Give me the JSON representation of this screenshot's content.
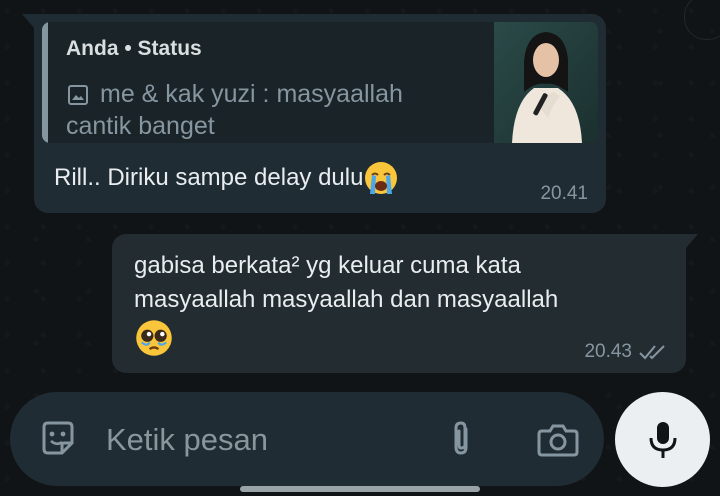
{
  "quoted_reply": {
    "author": "Anda • Status",
    "caption_line1": "me & kak yuzi : masyaallah",
    "caption_line2": "cantik banget",
    "media_icon": "image-icon"
  },
  "incoming_message": {
    "text": "Rill.. Diriku sampe delay dulu",
    "emoji": "loudly-crying-face",
    "time": "20.41"
  },
  "outgoing_message": {
    "line1": "gabisa berkata² yg keluar cuma kata",
    "line2": "masyaallah masyaallah dan masyaallah",
    "emoji": "pleading-face",
    "time": "20.43",
    "status_icon": "double-check-icon"
  },
  "composer": {
    "placeholder": "Ketik pesan",
    "left_icon": "sticker-icon",
    "attach_icon": "paperclip-icon",
    "camera_icon": "camera-icon",
    "send_icon": "mic-icon"
  },
  "colors": {
    "background": "#111417",
    "bubble_in": "#202c33",
    "bubble_out": "#232c31",
    "meta_text": "#8696a0",
    "mic_button": "#eceff1"
  }
}
